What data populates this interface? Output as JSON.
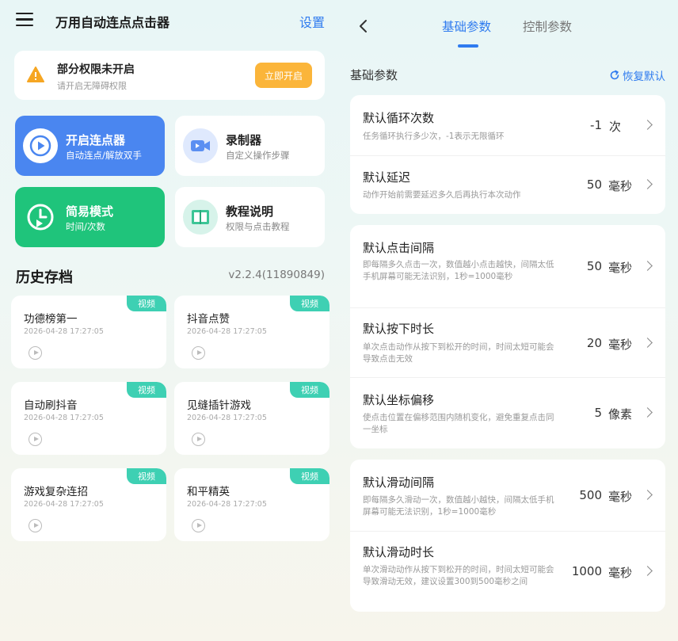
{
  "left": {
    "app_title": "万用自动连点点击器",
    "settings": "设置",
    "permission": {
      "title": "部分权限未开启",
      "subtitle": "请开启无障碍权限",
      "button": "立即开启"
    },
    "tiles": {
      "start": {
        "title": "开启连点器",
        "subtitle": "自动连点/解放双手"
      },
      "record": {
        "title": "录制器",
        "subtitle": "自定义操作步骤"
      },
      "simple": {
        "title": "简易模式",
        "subtitle": "时间/次数"
      },
      "guide": {
        "title": "教程说明",
        "subtitle": "权限与点击教程"
      }
    },
    "history_title": "历史存档",
    "version": "v2.2.4(11890849)",
    "history": [
      {
        "name": "功德榜第一",
        "date": "2026-04-28  17:27:05",
        "badge": "视频"
      },
      {
        "name": "抖音点赞",
        "date": "2026-04-28  17:27:05",
        "badge": "视频"
      },
      {
        "name": "自动刷抖音",
        "date": "2026-04-28  17:27:05",
        "badge": "视频"
      },
      {
        "name": "见缝插针游戏",
        "date": "2026-04-28  17:27:05",
        "badge": "视频"
      },
      {
        "name": "游戏复杂连招",
        "date": "2026-04-28  17:27:05",
        "badge": "视频"
      },
      {
        "name": "和平精英",
        "date": "2026-04-28  17:27:05",
        "badge": "视频"
      }
    ]
  },
  "right": {
    "tabs": {
      "basic": "基础参数",
      "control": "控制参数"
    },
    "section_title": "基础参数",
    "restore": "恢复默认",
    "rows": {
      "loop": {
        "title": "默认循环次数",
        "desc": "任务循环执行多少次，-1表示无限循环",
        "value": "-1",
        "unit": "次"
      },
      "delay": {
        "title": "默认延迟",
        "desc": "动作开始前需要延迟多久后再执行本次动作",
        "value": "50",
        "unit": "毫秒"
      },
      "click_interval": {
        "title": "默认点击间隔",
        "desc": "即每隔多久点击一次，数值越小点击越快，间隔太低手机屏幕可能无法识别，1秒=1000毫秒",
        "value": "50",
        "unit": "毫秒"
      },
      "press_time": {
        "title": "默认按下时长",
        "desc": "单次点击动作从按下到松开的时间，时间太短可能会导致点击无效",
        "value": "20",
        "unit": "毫秒"
      },
      "offset": {
        "title": "默认坐标偏移",
        "desc": "使点击位置在偏移范围内随机变化，避免重复点击同一坐标",
        "value": "5",
        "unit": "像素"
      },
      "swipe_interval": {
        "title": "默认滑动间隔",
        "desc": "即每隔多久滑动一次，数值越小越快，间隔太低手机屏幕可能无法识别，1秒=1000毫秒",
        "value": "500",
        "unit": "毫秒"
      },
      "swipe_time": {
        "title": "默认滑动时长",
        "desc": "单次滑动动作从按下到松开的时间，时间太短可能会导致滑动无效，建议设置300到500毫秒之间",
        "value": "1000",
        "unit": "毫秒"
      }
    }
  }
}
